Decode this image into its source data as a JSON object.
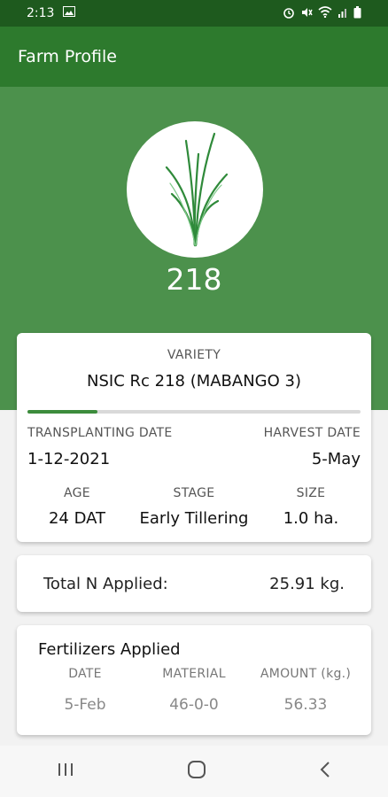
{
  "status": {
    "time": "2:13"
  },
  "app_bar": {
    "title": "Farm Profile"
  },
  "profile": {
    "number": "218"
  },
  "variety": {
    "label": "VARIETY",
    "name": "NSIC Rc 218 (MABANGO 3)",
    "progress": 0.21
  },
  "dates": {
    "transplanting_label": "TRANSPLANTING DATE",
    "transplanting_value": "1-12-2021",
    "harvest_label": "HARVEST DATE",
    "harvest_value": "5-May"
  },
  "stats": {
    "age_label": "AGE",
    "age_value": "24 DAT",
    "stage_label": "STAGE",
    "stage_value": "Early Tillering",
    "size_label": "SIZE",
    "size_value": "1.0 ha."
  },
  "total_n": {
    "label": "Total N Applied:",
    "value": "25.91 kg."
  },
  "fertilizers": {
    "title": "Fertilizers Applied",
    "headers": [
      "DATE",
      "MATERIAL",
      "AMOUNT (kg.)"
    ],
    "rows": [
      [
        "5-Feb",
        "46-0-0",
        "56.33"
      ]
    ]
  },
  "colors": {
    "dark_green": "#1e5a1e",
    "green": "#2d7a2d",
    "hero_green": "#4c914c"
  }
}
